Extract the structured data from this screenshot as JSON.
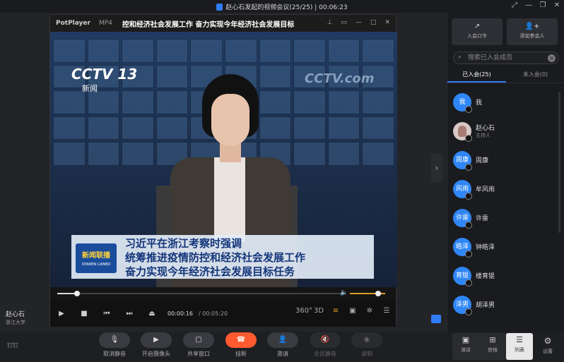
{
  "titlebar": {
    "title": "赵心石发起的视频会议(25/25) | 00:06:23",
    "icons": [
      "pin-icon",
      "minimize-icon",
      "restore-icon",
      "close-icon"
    ]
  },
  "player": {
    "logo": "PotPlayer",
    "format": "MP4",
    "title": "控和经济社会发展工作 奋力实现今年经济社会发展目标",
    "controls": [
      "pin-icon",
      "mini-icon",
      "minimize-icon",
      "maximize-icon",
      "close-icon"
    ],
    "video": {
      "channel_logo": "CCTV 13",
      "channel_sub": "新闻",
      "wall_logo": "CCTV.com",
      "news_badge": "新闻联播",
      "news_badge_sub": "XINWEN LIANBO",
      "headline": [
        "习近平在浙江考察时强调",
        "统筹推进疫情防控和经济社会发展工作",
        "奋力实现今年经济社会发展目标任务"
      ]
    },
    "progress_fraction": 0.07,
    "volume_fraction": 0.75,
    "time_current": "00:00:16",
    "time_total": "/ 00:05:20",
    "right_controls": [
      "360°",
      "3D",
      "subtitle-icon",
      "screen-icon",
      "gear-icon",
      "menu-icon"
    ]
  },
  "host": {
    "name": "赵心石",
    "org": "浙江大学"
  },
  "toolbar": {
    "brand": "钉钉",
    "items": [
      {
        "label": "取消静音",
        "icon": "mic-icon",
        "state": "normal"
      },
      {
        "label": "开启摄像头",
        "icon": "camera-icon",
        "state": "normal"
      },
      {
        "label": "共享窗口",
        "icon": "share-icon",
        "state": "normal"
      },
      {
        "label": "挂断",
        "icon": "hangup-icon",
        "state": "danger"
      },
      {
        "label": "邀请",
        "icon": "invite-icon",
        "state": "normal"
      },
      {
        "label": "全员静音",
        "icon": "mute-all-icon",
        "state": "disabled"
      },
      {
        "label": "录制",
        "icon": "record-icon",
        "state": "disabled"
      }
    ],
    "layouts": [
      {
        "label": "演讲",
        "icon": "speaker-icon",
        "active": false
      },
      {
        "label": "宫格",
        "icon": "grid-icon",
        "active": false
      },
      {
        "label": "列表",
        "icon": "list-icon",
        "active": true
      }
    ],
    "settings_label": "设置"
  },
  "panel": {
    "actions": [
      {
        "label": "入会口令",
        "icon": "share-link-icon"
      },
      {
        "label": "添加参会人",
        "icon": "add-user-icon"
      }
    ],
    "search_placeholder": "搜索已入会成员",
    "tabs": [
      {
        "label": "已入会(25)",
        "active": true
      },
      {
        "label": "未入会(0)",
        "active": false
      }
    ],
    "members": [
      {
        "name": "我",
        "avatar": "我",
        "role": ""
      },
      {
        "name": "赵心石",
        "avatar": "",
        "role": "主持人"
      },
      {
        "name": "周康",
        "avatar": "周康",
        "role": ""
      },
      {
        "name": "牟风雨",
        "avatar": "风雨",
        "role": ""
      },
      {
        "name": "许雷",
        "avatar": "许雷",
        "role": ""
      },
      {
        "name": "钟皓泽",
        "avatar": "皓泽",
        "role": ""
      },
      {
        "name": "楼育锟",
        "avatar": "育锟",
        "role": ""
      },
      {
        "name": "胡泽男",
        "avatar": "泽男",
        "role": ""
      }
    ]
  },
  "colors": {
    "accent": "#2f7cf6",
    "hangup": "#ff5a30",
    "background": "#1c1d20"
  }
}
